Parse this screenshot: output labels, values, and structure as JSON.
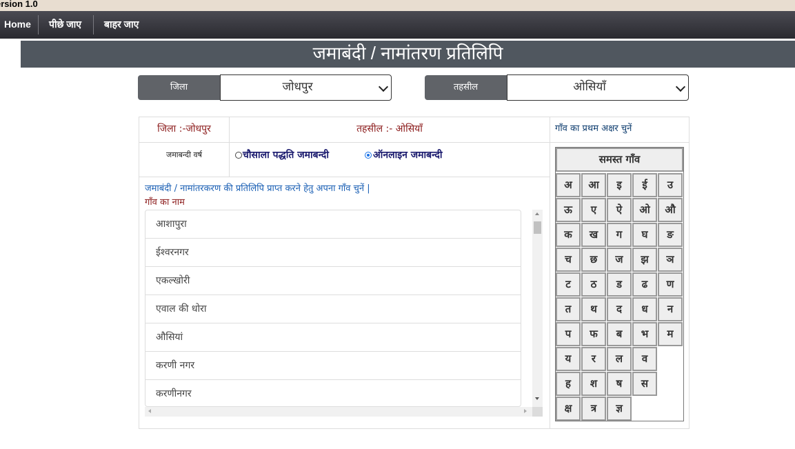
{
  "version": "ersion 1.0",
  "nav": {
    "home": "Home",
    "back": "पीछे जाए",
    "exit": "बाहर जाए"
  },
  "title": "जमाबंदी / नामांतरण प्रतिलिपि",
  "district": {
    "label": "जिला",
    "value": "जोधपुर"
  },
  "tehsil": {
    "label": "तहसील",
    "value": "ओसियाँ"
  },
  "info": {
    "district_text": "जिला :-जोधपुर",
    "tehsil_text": "तहसील :- ओसियाँ",
    "letter_prompt": "गाँव का प्रथम अक्षर चुनें",
    "year_label": "जमाबन्दी वर्ष",
    "option_a": "चौसाला पद्धति जमाबन्दी",
    "option_b": "ऑनलाइन जमाबन्दी",
    "instruction": "जमाबंदी / नामांतरकरण की प्रतिलिपि प्राप्त करने हेतु अपना गाँव चुनें |",
    "village_label": "गाँव का नाम"
  },
  "villages": [
    "आशापुरा",
    "ईश्वरनगर",
    "एकल्खोरी",
    "एवाल की धोरा",
    "औसियां",
    "करणी नगर",
    "करणीनगर"
  ],
  "all_villages": "समस्त गाँव",
  "letters": [
    [
      "अ",
      "आ",
      "इ",
      "ई",
      "उ"
    ],
    [
      "ऊ",
      "ए",
      "ऐ",
      "ओ",
      "औ"
    ],
    [
      "क",
      "ख",
      "ग",
      "घ",
      "ङ"
    ],
    [
      "च",
      "छ",
      "ज",
      "झ",
      "ञ"
    ],
    [
      "ट",
      "ठ",
      "ड",
      "ढ",
      "ण"
    ],
    [
      "त",
      "थ",
      "द",
      "ध",
      "न"
    ],
    [
      "प",
      "फ",
      "ब",
      "भ",
      "म"
    ],
    [
      "य",
      "र",
      "ल",
      "व"
    ],
    [
      "ह",
      "श",
      "ष",
      "स"
    ],
    [
      "क्ष",
      "त्र",
      "ज्ञ"
    ]
  ]
}
